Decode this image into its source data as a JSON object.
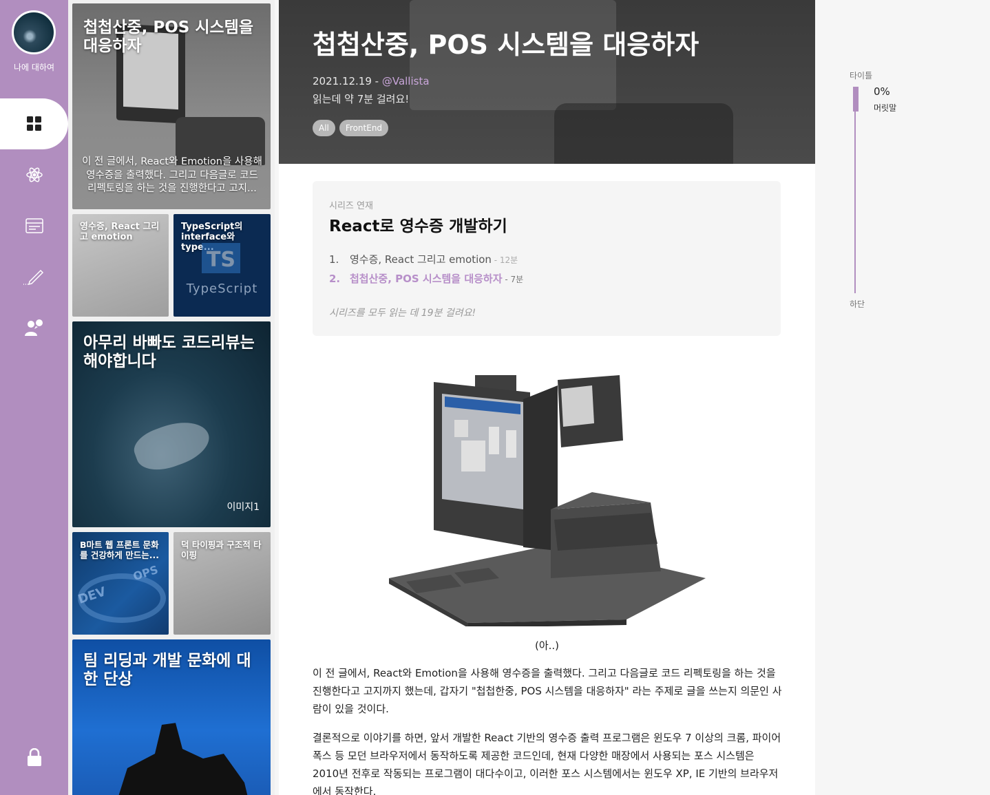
{
  "sidebar": {
    "profile_label": "나에 대하여",
    "nav_items": [
      {
        "icon": "grid-icon"
      },
      {
        "icon": "react-icon"
      },
      {
        "icon": "card-icon"
      },
      {
        "icon": "pencil-icon"
      },
      {
        "icon": "people-icon"
      }
    ],
    "lock_icon": "lock-icon",
    "accent_color": "#b18ebf"
  },
  "cards": [
    {
      "title": "첩첩산중, POS 시스템을 대응하자",
      "excerpt": "이 전 글에서, React와 Emotion을 사용해 영수증을 출력했다. 그리고 다음글로 코드 리펙토링을 하는 것을 진행한다고 고지..."
    },
    {
      "title": "영수증, React 그리고 emotion"
    },
    {
      "title": "TypeScript의 interface와 type...",
      "logo_text": "TS",
      "logo_word": "TypeScript"
    },
    {
      "title": "아무리 바빠도 코드리뷰는 해야합니다",
      "image_label": "이미지1"
    },
    {
      "title": "B마트 웹 프론트 문화를 건강하게 만드는...",
      "art_text_dev": "DEV",
      "art_text_ops": "OPS"
    },
    {
      "title": "덕 타이핑과 구조적 타이핑"
    },
    {
      "title": "팀 리딩과 개발 문화에 대한 단상"
    }
  ],
  "post": {
    "title": "첩첩산중, POS 시스템을 대응하자",
    "date": "2021.12.19 - ",
    "author": "@Vallista",
    "read_time": "읽는데 약 7분 걸려요!",
    "tags": [
      "All",
      "FrontEnd"
    ]
  },
  "series": {
    "caption": "시리즈 연재",
    "name": "React로 영수증 개발하기",
    "items": [
      {
        "num": "1.",
        "title": "영수증, React 그리고 emotion",
        "minutes": " - 12분",
        "current": false
      },
      {
        "num": "2.",
        "title": "첩첩산중, POS 시스템을 대응하자",
        "minutes": " - 7분",
        "current": true
      }
    ],
    "total": "시리즈를 모두 읽는 데 19분 걸려요!"
  },
  "content": {
    "image_caption": "(아..)",
    "paragraphs": [
      "이 전 글에서, React와 Emotion을 사용해 영수증을 출력했다. 그리고 다음글로 코드 리펙토링을 하는 것을 진행한다고 고지까지 했는데, 갑자기 \"첩첩한중, POS 시스템을 대응하자\" 라는 주제로 글을 쓰는지 의문인 사람이 있을 것이다.",
      "결론적으로 이야기를 하면, 앞서 개발한 React 기반의 영수증 출력 프로그램은 윈도우 7 이상의 크롬, 파이어폭스 등 모던 브라우저에서 동작하도록 제공한 코드인데, 현재 다양한 매장에서 사용되는 포스 시스템은 2010년 전후로 작동되는 프로그램이 대다수이고, 이러한 포스 시스템에서는 윈도우 XP, IE 기반의 브라우저에서 동작한다."
    ]
  },
  "toc": {
    "top_label": "타이틀",
    "progress_text": "0%",
    "progress": 0,
    "heading": "머릿말",
    "bottom_label": "하단"
  }
}
